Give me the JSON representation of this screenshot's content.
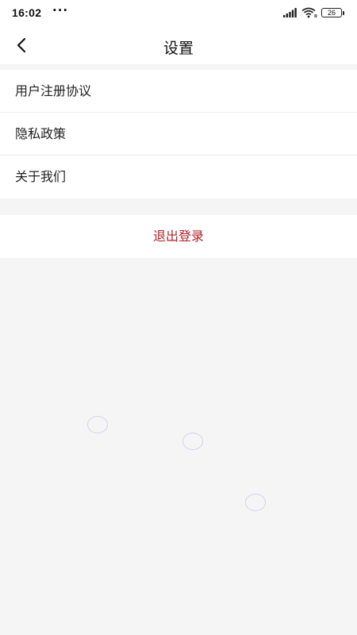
{
  "status_bar": {
    "time": "16:02",
    "dots": "···",
    "battery": "26"
  },
  "header": {
    "title": "设置"
  },
  "menu": {
    "items": [
      {
        "label": "用户注册协议"
      },
      {
        "label": "隐私政策"
      },
      {
        "label": "关于我们"
      }
    ]
  },
  "logout": {
    "label": "退出登录"
  },
  "colors": {
    "accent_red": "#b51f26",
    "background": "#f6f5f6",
    "card": "#ffffff"
  },
  "icons": [
    "signal-icon",
    "wifi-icon",
    "battery-icon",
    "back-chevron-icon"
  ]
}
